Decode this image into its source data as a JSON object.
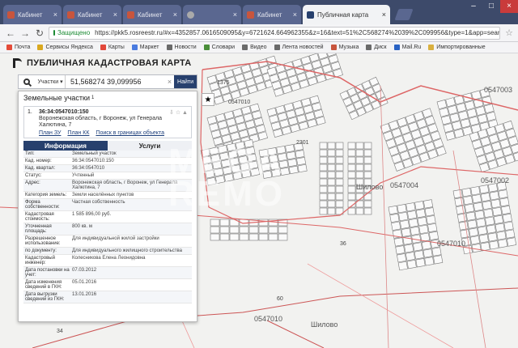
{
  "browser": {
    "tabs": [
      {
        "label": "Кабинет"
      },
      {
        "label": "Кабинет"
      },
      {
        "label": "Кабинет"
      },
      {
        "label": ""
      },
      {
        "label": "Кабинет"
      },
      {
        "label": "Публичная карта"
      }
    ],
    "url_secure": "Защищено",
    "url": "https://pkk5.rosreestr.ru/#x=4352857.0616509095&y=6721624.664962355&z=16&text=51%2C568274%2039%2C099956&type=1&app=search&op",
    "bookmarks": [
      {
        "label": "Почта",
        "color": "#e44b3a"
      },
      {
        "label": "Сервисы Яндекса",
        "color": "#d9a820"
      },
      {
        "label": "Карты",
        "color": "#e2473a"
      },
      {
        "label": "Маркет",
        "color": "#4a7be0"
      },
      {
        "label": "Новости",
        "color": "#6a6a6a"
      },
      {
        "label": "Словари",
        "color": "#4a8e3a"
      },
      {
        "label": "Видео",
        "color": "#6a6a6a"
      },
      {
        "label": "Лента новостей",
        "color": "#6a6a6a"
      },
      {
        "label": "Музыка",
        "color": "#c8553d"
      },
      {
        "label": "Диск",
        "color": "#6a6a6a"
      },
      {
        "label": "Mail.Ru",
        "color": "#2a63c4"
      },
      {
        "label": "Импортированные",
        "color": "#d9b040"
      }
    ]
  },
  "app": {
    "title": "ПУБЛИЧНАЯ КАДАСТРОВАЯ КАРТА",
    "search_type": "Участки",
    "search_value": "51,568274 39,099956",
    "find_label": "Найти",
    "panel_title": "Земельные участки",
    "panel_count": "1",
    "result": {
      "num": "1.",
      "id": "36:34:0547010:150",
      "address": "Воронежская область, г Воронеж, ул Генерала Халютина, 7",
      "links": [
        "План ЗУ",
        "План КК",
        "Поиск в границах объекта"
      ]
    },
    "tab_info": "Информация",
    "tab_services": "Услуги",
    "info": [
      {
        "k": "Тип:",
        "v": "Земельный участок"
      },
      {
        "k": "Кад. номер:",
        "v": "36:34:0547010:150"
      },
      {
        "k": "Кад. квартал:",
        "v": "36:34:0547010"
      },
      {
        "k": "Статус:",
        "v": "Учтенный"
      },
      {
        "k": "Адрес:",
        "v": "Воронежская область, г Воронеж, ул Генерала Халютина, 7"
      },
      {
        "k": "Категория земель:",
        "v": "Земли населённых пунктов"
      },
      {
        "k": "Форма собственности:",
        "v": "Частная собственность"
      },
      {
        "k": "Кадастровая стоимость:",
        "v": "1 585 896,00 руб."
      },
      {
        "k": "Уточненная площадь:",
        "v": "800 кв. м"
      },
      {
        "k": "Разрешенное использование:",
        "v": "Для индивидуальной жилой застройки"
      },
      {
        "k": "по документу:",
        "v": "Для индивидуального жилищного строительства"
      },
      {
        "k": "Кадастровый инженер:",
        "v": "Колесникова Елена Леонидовна"
      },
      {
        "k": "Дата постановки на учет:",
        "v": "07.03.2012"
      },
      {
        "k": "Дата изменения сведений в ГКН:",
        "v": "05.01.2016"
      },
      {
        "k": "Дата выгрузки сведений из ГКН:",
        "v": "13.01.2016"
      }
    ]
  },
  "map": {
    "labels": {
      "q1": "0547010",
      "q2": "0547004",
      "q3": "0547002",
      "q4": "0547010",
      "q5": "0547010",
      "q6": "0547003",
      "village": "Шилово",
      "village2": "Шилово",
      "n1375": "1375",
      "n2301": "2301",
      "n60": "60",
      "n34": "34",
      "n36": "36"
    }
  },
  "watermark": "MEGA\nREMO"
}
